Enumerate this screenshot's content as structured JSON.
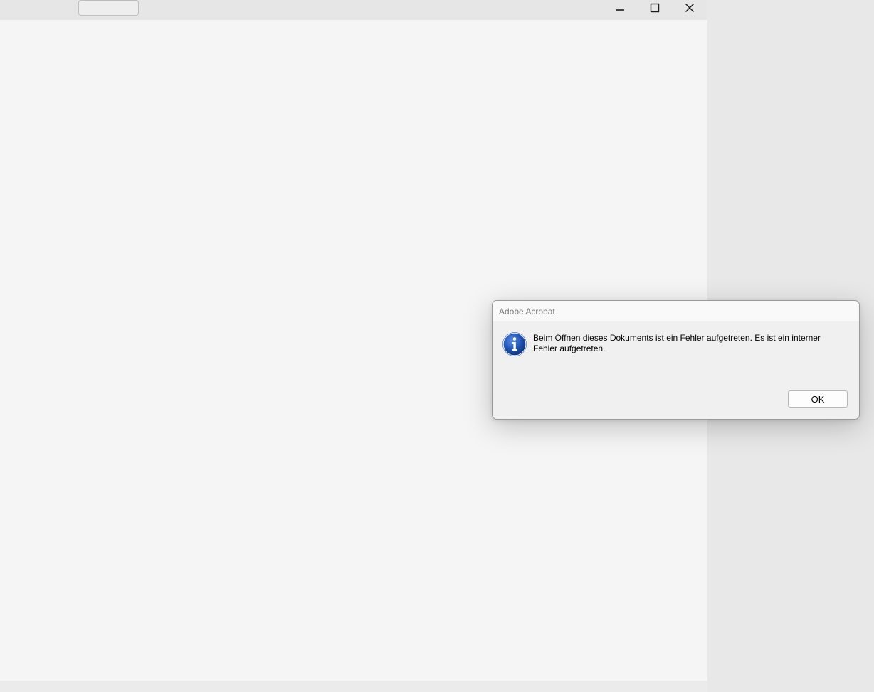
{
  "window": {
    "controls": {
      "minimize_icon": "minimize-icon",
      "maximize_icon": "maximize-icon",
      "close_icon": "close-icon"
    }
  },
  "dialog": {
    "title": "Adobe Acrobat",
    "icon": "info-icon",
    "message": "Beim Öffnen dieses Dokuments ist ein Fehler aufgetreten. Es ist ein interner Fehler aufgetreten.",
    "ok_label": "OK"
  },
  "colors": {
    "info_icon_fill": "#1c4fae",
    "canvas_background": "#f5f5f5",
    "dialog_background": "#f0f0f0"
  }
}
